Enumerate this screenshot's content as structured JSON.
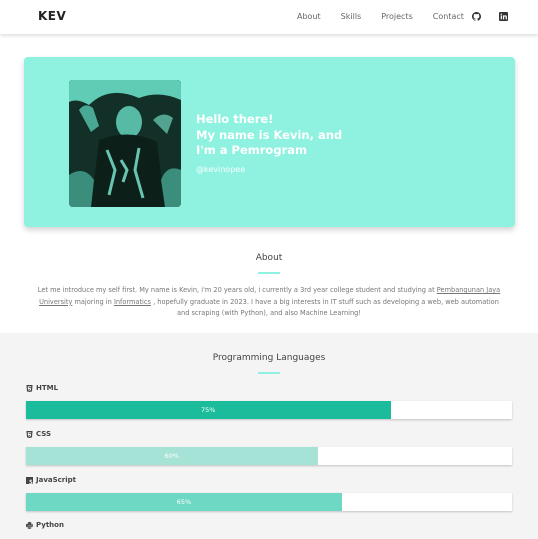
{
  "nav": {
    "brand": "KEV",
    "links": [
      "About",
      "Skills",
      "Projects",
      "Contact"
    ],
    "icons": [
      "github-icon",
      "linkedin-icon"
    ]
  },
  "hero": {
    "greeting_line1": "Hello there!",
    "greeting_line2": "My name is Kevin, and",
    "greeting_line3": "I'm a Pemrogram",
    "handle": "@kevinopee",
    "bg_color": "#8ff2e0"
  },
  "about": {
    "title": "About",
    "text_before": "Let me introduce my self first. My name is Kevin, i'm 20 years old, i currently a 3rd year college student and studying at",
    "university": "Pembangunan Jaya University",
    "text_mid": "majoring in",
    "major": "Informatics",
    "text_after": ", hopefully graduate in 2023. I have a big interests in IT stuff such as developing a web, web automation and scraping (with Python), and also Machine Learning!"
  },
  "skills": {
    "title": "Programming Languages",
    "items": [
      {
        "name": "HTML",
        "percent_label": "75%",
        "percent": 75,
        "color": "#1bbc9b",
        "icon": "html5-icon"
      },
      {
        "name": "CSS",
        "percent_label": "60%",
        "percent": 60,
        "color": "#a5e3d6",
        "icon": "css3-icon"
      },
      {
        "name": "JavaScript",
        "percent_label": "65%",
        "percent": 65,
        "color": "#6fd8c4",
        "icon": "javascript-icon"
      },
      {
        "name": "Python",
        "icon": "python-icon"
      }
    ]
  }
}
